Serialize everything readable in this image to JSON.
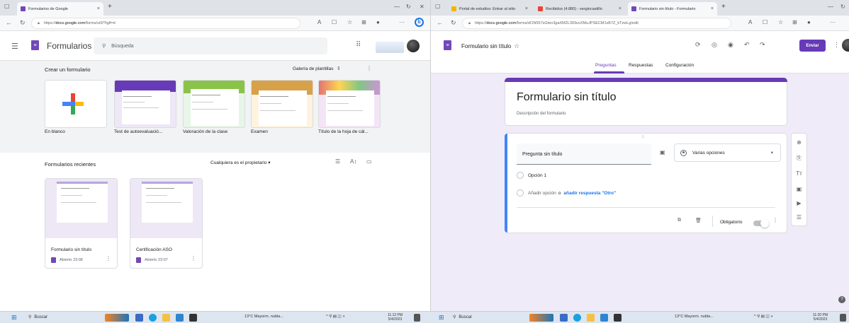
{
  "left": {
    "tabs": [
      {
        "label": "Formularios de Google"
      }
    ],
    "url_prefix": "https://",
    "url_domain": "docs.google.com",
    "url_rest": "/forms/u/0/?tgif=d",
    "app_name": "Formularios",
    "search_placeholder": "Búsqueda",
    "create_title": "Crear un formulario",
    "gallery_label": "Galería de plantillas",
    "templates": [
      {
        "label": "En blanco"
      },
      {
        "label": "Test de autoevaluació..."
      },
      {
        "label": "Valoración de la clase"
      },
      {
        "label": "Examen"
      },
      {
        "label": "Título de la hoja de cál..."
      }
    ],
    "recent_title": "Formularios recientes",
    "owner_filter": "Cualquiera es el propietario",
    "recent": [
      {
        "name": "Formulario sin título",
        "opened": "Abierto 23:08"
      },
      {
        "name": "Certificación ASO",
        "opened": "Abierto 23:07"
      }
    ]
  },
  "right": {
    "tabs": [
      {
        "label": "Portal de estudios: Entrar al sitio"
      },
      {
        "label": "Recibidos (4.880) - sergiocastillo"
      },
      {
        "label": "Formulario sin título - Formulario"
      }
    ],
    "url_prefix": "https://",
    "url_domain": "docs.google.com",
    "url_rest": "/forms/d/1N557sGten3gaXM2L393uvXMuJPSECM1xB7Z_kTzwLg/edit",
    "form_title": "Formulario sin título",
    "send_label": "Enviar",
    "tabs_form": [
      "Preguntas",
      "Respuestas",
      "Configuración"
    ],
    "card_title": "Formulario sin título",
    "card_desc": "Descripción del formulario",
    "question": "Pregunta sin título",
    "qtype": "Varias opciones",
    "option1": "Opción 1",
    "add_option": "Añadir opción",
    "or_text": "o",
    "add_other": "añadir respuesta \"Otro\"",
    "required_label": "Obligatorio"
  },
  "taskbar": {
    "search_label": "Buscar",
    "weather": "13°C  Mayorm. nubla...",
    "time_left": "11:12 PM",
    "date_left": "5/4/2023",
    "time_right": "11:20 PM",
    "date_right": "5/4/2023"
  },
  "colors": {
    "forms_purple": "#673ab7",
    "google_blue": "#1a73e8"
  }
}
